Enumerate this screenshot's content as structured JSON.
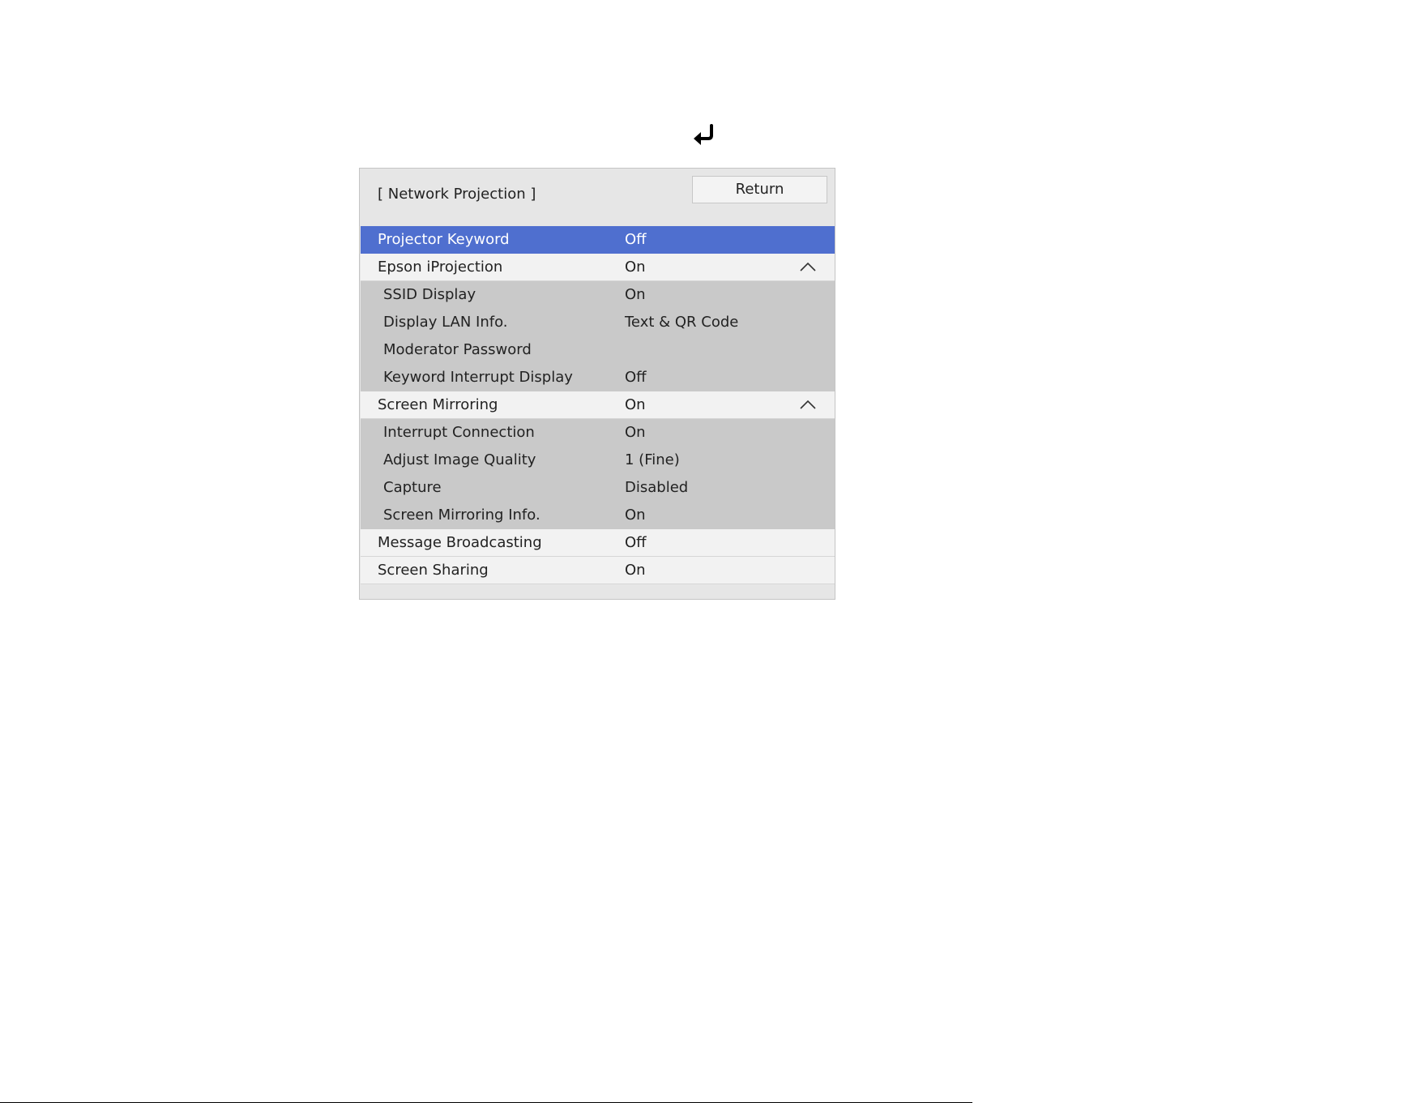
{
  "header": {
    "enter_icon": "enter-return-icon"
  },
  "panel": {
    "title": "[ Network Projection ]",
    "return_label": "Return"
  },
  "colors": {
    "selected_row": "#4f6fcf",
    "top_row": "#f2f2f2",
    "sub_row": "#c9c9c9",
    "panel_bg": "#e6e6e6"
  },
  "menu": [
    {
      "label": "Projector Keyword",
      "value": "Off",
      "selected": true,
      "level": "top"
    },
    {
      "label": "Epson iProjection",
      "value": "On",
      "level": "top",
      "expanded": true
    },
    {
      "label": "SSID Display",
      "value": "On",
      "level": "sub"
    },
    {
      "label": "Display LAN Info.",
      "value": "Text & QR Code",
      "level": "sub"
    },
    {
      "label": "Moderator Password",
      "value": "",
      "level": "sub"
    },
    {
      "label": "Keyword Interrupt Display",
      "value": "Off",
      "level": "sub"
    },
    {
      "label": "Screen Mirroring",
      "value": "On",
      "level": "top",
      "expanded": true
    },
    {
      "label": "Interrupt Connection",
      "value": "On",
      "level": "sub"
    },
    {
      "label": "Adjust Image Quality",
      "value": "1 (Fine)",
      "level": "sub"
    },
    {
      "label": "Capture",
      "value": "Disabled",
      "level": "sub"
    },
    {
      "label": "Screen Mirroring Info.",
      "value": "On",
      "level": "sub"
    },
    {
      "label": "Message Broadcasting",
      "value": "Off",
      "level": "top"
    },
    {
      "label": "Screen Sharing",
      "value": "On",
      "level": "top"
    }
  ]
}
